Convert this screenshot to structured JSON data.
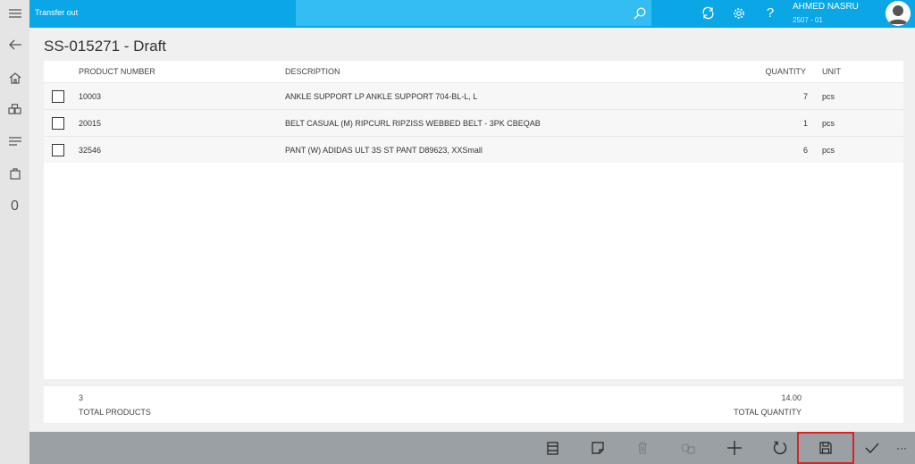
{
  "app": {
    "title": "Transfer out"
  },
  "user": {
    "name": "AHMED NASRU",
    "store": "2507 - 01"
  },
  "rail": {
    "cart_count": "0"
  },
  "page": {
    "title": "SS-015271 - Draft"
  },
  "table": {
    "headers": {
      "product_number": "PRODUCT NUMBER",
      "description": "DESCRIPTION",
      "quantity": "QUANTITY",
      "unit": "UNIT"
    },
    "rows": [
      {
        "product_number": "10003",
        "description": "ANKLE SUPPORT LP ANKLE SUPPORT 704-BL-L, L",
        "quantity": "7",
        "unit": "pcs"
      },
      {
        "product_number": "20015",
        "description": "BELT CASUAL (M) RIPCURL RIPZISS WEBBED BELT - 3PK CBEQAB",
        "quantity": "1",
        "unit": "pcs"
      },
      {
        "product_number": "32546",
        "description": "PANT (W) ADIDAS ULT 3S ST PANT D89623, XXSmall",
        "quantity": "6",
        "unit": "pcs"
      }
    ]
  },
  "summary": {
    "total_products_value": "3",
    "total_products_label": "TOTAL PRODUCTS",
    "total_quantity_value": "14.00",
    "total_quantity_label": "TOTAL QUANTITY"
  },
  "colors": {
    "accent": "#0aa6e6",
    "command_bar": "#9aa0a4",
    "highlight": "#dd2222"
  },
  "commands": [
    "details-icon",
    "note-icon",
    "delete-icon",
    "packing-icon",
    "add-icon",
    "refresh-icon",
    "save-icon",
    "commit-icon",
    "more-icon"
  ],
  "commands_more_label": "···"
}
